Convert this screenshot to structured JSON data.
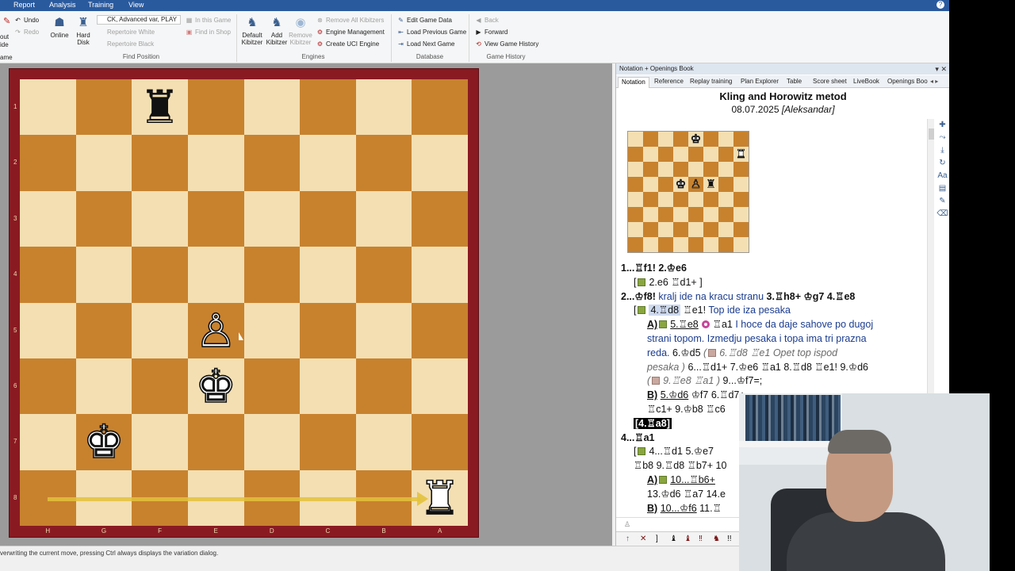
{
  "menu": {
    "items": [
      "Report",
      "Analysis",
      "Training",
      "View"
    ]
  },
  "ribbon": {
    "undo": "Undo",
    "redo": "Redo",
    "left_partial_1": "out",
    "left_partial_2": "ide",
    "left_partial_3": "ame",
    "online": "Online",
    "hard_disk_1": "Hard",
    "hard_disk_2": "Disk",
    "engine_select": "CK, Advanced var, PLAY",
    "repertoire_white": "Repertoire White",
    "repertoire_black": "Repertoire Black",
    "in_this_game": "In this Game",
    "find_in_shop": "Find in Shop",
    "find_position": "Find Position",
    "default_kibitzer_1": "Default",
    "default_kibitzer_2": "Kibitzer",
    "add_kibitzer_1": "Add",
    "add_kibitzer_2": "Kibitzer",
    "remove_kibitzer_1": "Remove",
    "remove_kibitzer_2": "Kibitzer",
    "remove_all_kibitzers": "Remove All Kibitzers",
    "engine_management": "Engine Management",
    "create_uci_engine": "Create UCI Engine",
    "engines": "Engines",
    "edit_game_data": "Edit Game Data",
    "load_previous_game": "Load Previous Game",
    "load_next_game": "Load Next Game",
    "database": "Database",
    "back": "Back",
    "forward": "Forward",
    "view_game_history": "View Game History",
    "game_history": "Game History"
  },
  "board": {
    "ranks": [
      "1",
      "2",
      "3",
      "4",
      "5",
      "6",
      "7",
      "8"
    ],
    "files": [
      "H",
      "G",
      "F",
      "E",
      "D",
      "C",
      "B",
      "A"
    ],
    "pieces": [
      {
        "glyph": "♜",
        "color": "black",
        "col": 2,
        "row": 0
      },
      {
        "glyph": "♙",
        "color": "white",
        "col": 3,
        "row": 4
      },
      {
        "glyph": "♚",
        "color": "white",
        "col": 3,
        "row": 5
      },
      {
        "glyph": "♚",
        "color": "white",
        "col": 1,
        "row": 6
      },
      {
        "glyph": "♜",
        "color": "white",
        "col": 7,
        "row": 7
      }
    ],
    "colors": {
      "light": "#f3dfb2",
      "dark": "#c8822e",
      "frame": "#8a1a22",
      "arrow": "#e3c23c"
    }
  },
  "panel": {
    "title": "Notation + Openings Book",
    "tabs": [
      "Notation",
      "Reference",
      "Replay training",
      "Plan Explorer",
      "Table",
      "Score sheet",
      "LiveBook",
      "Openings Boo"
    ],
    "game_title": "Kling and Horowitz metod",
    "game_date": "08.07.2025",
    "game_author": "[Aleksandar]",
    "mini_pieces": [
      {
        "glyph": "♚",
        "color": "white",
        "col": 4,
        "row": 0
      },
      {
        "glyph": "♜",
        "color": "white",
        "col": 7,
        "row": 1
      },
      {
        "glyph": "♚",
        "color": "white",
        "col": 3,
        "row": 3
      },
      {
        "glyph": "♙",
        "color": "white",
        "col": 4,
        "row": 3
      },
      {
        "glyph": "♜",
        "color": "black",
        "col": 5,
        "row": 3
      }
    ]
  },
  "notation": {
    "l1a": "1...",
    "l1b": "♖f1!",
    "l1c": "2.",
    "l1d": "♔e6",
    "l2a": "[",
    "l2b": "2.e6",
    "l2c": "♖d1+",
    "l2d": "]",
    "l3a": "2...",
    "l3b": "♔f8!",
    "l3c": "kralj ide na kracu stranu",
    "l3d": "3.♖h8+",
    "l3e": "♔g7",
    "l3f": "4.♖e8",
    "l4a": "[",
    "l4b": "4.♖d8",
    "l4c": "♖e1!",
    "l4d": "Top ide iza pesaka",
    "l5a": "A)",
    "l5b": "5.♖e8",
    "l5c": "♖a1",
    "l5d": "I hoce da daje sahove po dugoj",
    "l6": "strani topom. Izmedju pesaka i topa ima tri prazna",
    "l7a": "reda.",
    "l7b": "6.♔d5",
    "l7c": "(",
    "l7d": "6.♖d8",
    "l7e": "♖e1",
    "l7f": "Opet top ispod",
    "l8a": "pesaka",
    "l8b": ")",
    "l8c": "6...♖d1+",
    "l8d": "7.♔e6",
    "l8e": "♖a1",
    "l8f": "8.♖d8",
    "l8g": "♖e1!",
    "l8h": "9.♔d6",
    "l9a": "(",
    "l9b": "9.♖e8",
    "l9c": "♖a1",
    "l9d": ")",
    "l9e": "9...♔f7=;",
    "l10a": "B)",
    "l10b": "5.♔d6",
    "l10c": "♔f7",
    "l10d": "6.♖d7+",
    "l11a": "♖c1+",
    "l11b": "9.♔b8",
    "l11c": "♖c6",
    "l12": "[4.♖a8]",
    "l13": "4...♖a1",
    "l14a": "[",
    "l14b": "4...♖d1",
    "l14c": "5.♔e7",
    "l15a": "♖b8",
    "l15b": "9.♖d8",
    "l15c": "♖b7+",
    "l15d": "10",
    "l16a": "A)",
    "l16b": "10...♖b6+",
    "l17a": "13.♔d6",
    "l17b": "♖a7",
    "l17c": "14.e",
    "l18a": "B)",
    "l18b": "10...♔f6",
    "l18c": "11.♖"
  },
  "status": {
    "text": "verwriting the current move, pressing Ctrl always displays the variation dialog."
  }
}
